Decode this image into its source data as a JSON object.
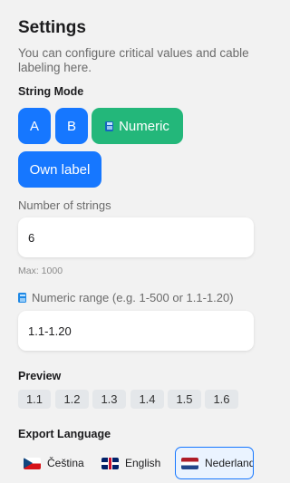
{
  "header": {
    "title": "Settings",
    "subtitle": "You can configure critical values and cable labeling here."
  },
  "string_mode": {
    "label": "String Mode",
    "options": [
      "A",
      "B",
      "Numeric",
      "Own label"
    ],
    "selected": "Numeric",
    "colors": {
      "default": "#1677ff",
      "active": "#23b77a"
    },
    "active_icon": "calculator-icon"
  },
  "number_of_strings": {
    "label": "Number of strings",
    "value": "6",
    "hint": "Max: 1000"
  },
  "numeric_range": {
    "label": "Numeric range (e.g. 1-500 or 1.1-1.20)",
    "icon": "calculator-icon",
    "value": "1.1-1.20"
  },
  "preview": {
    "label": "Preview",
    "items": [
      "1.1",
      "1.2",
      "1.3",
      "1.4",
      "1.5",
      "1.6"
    ]
  },
  "export_language": {
    "label": "Export Language",
    "options": [
      {
        "label": "Čeština",
        "flag": "czech-flag-icon"
      },
      {
        "label": "English",
        "flag": "uk-flag-icon"
      },
      {
        "label": "Nederlands",
        "flag": "netherlands-flag-icon"
      }
    ],
    "selected": "Nederlands"
  }
}
